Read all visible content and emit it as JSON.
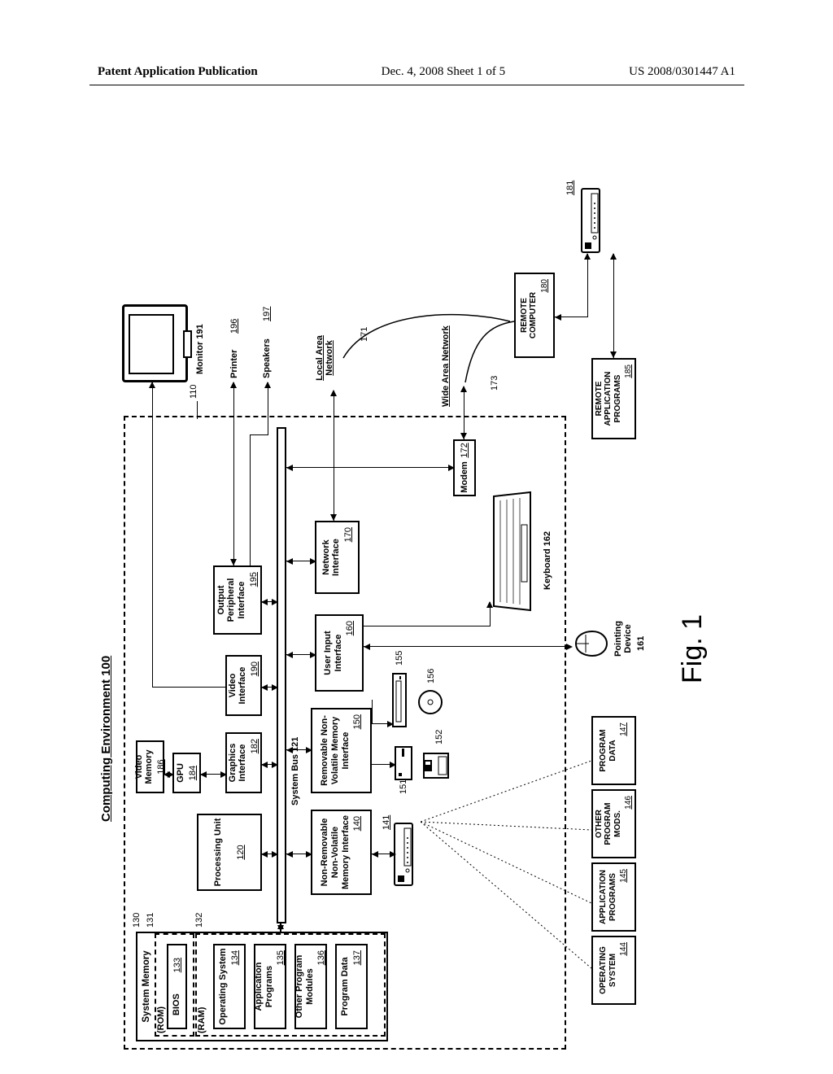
{
  "header": {
    "left": "Patent Application Publication",
    "center": "Dec. 4, 2008   Sheet 1 of 5",
    "right": "US 2008/0301447 A1"
  },
  "doc_title": "Computing Environment 100",
  "figure_label": "Fig. 1",
  "system_memory": {
    "title": "System Memory",
    "rom": "(ROM)",
    "ram": "(RAM)",
    "ref130": "130",
    "ref131": "131",
    "ref132": "132",
    "bios": "BIOS",
    "bios_ref": "133",
    "os": "Operating System",
    "os_ref": "134",
    "app": "Application Programs",
    "app_ref": "135",
    "other": "Other Program Modules",
    "other_ref": "136",
    "pdata": "Program Data",
    "pdata_ref": "137"
  },
  "cpu": {
    "label": "Processing Unit",
    "ref": "120"
  },
  "gpu": {
    "label": "GPU",
    "ref": "184"
  },
  "vmem": {
    "label": "Video Memory",
    "ref": "186"
  },
  "gfx": {
    "label": "Graphics Interface",
    "ref": "182"
  },
  "bus": "System Bus 121",
  "nrnv": {
    "label": "Non-Removable Non-Volatile Memory Interface",
    "ref": "140"
  },
  "rnv": {
    "label": "Removable Non-Volatile Memory Interface",
    "ref": "150"
  },
  "vint": {
    "label": "Video Interface",
    "ref": "190"
  },
  "opi": {
    "label": "Output Peripheral Interface",
    "ref": "195"
  },
  "uii": {
    "label": "User Input Interface",
    "ref": "160"
  },
  "nif": {
    "label": "Network Interface",
    "ref": "170"
  },
  "modem": {
    "label": "Modem",
    "ref": "172"
  },
  "monitor": "Monitor 191",
  "printer": "Printer",
  "printer_ref": "196",
  "speakers": "Speakers",
  "speakers_ref": "197",
  "lan": "Local Area Network",
  "wan": "Wide Area Network",
  "kbd": "Keyboard 162",
  "mouse": "Pointing Device",
  "mouse_ref": "161",
  "remote": {
    "label": "REMOTE COMPUTER",
    "ref": "180"
  },
  "rap": {
    "label": "REMOTE APPLICATION PROGRAMS",
    "ref": "185"
  },
  "hdd": {
    "os": "OPERATING SYSTEM",
    "os_ref": "144",
    "app": "APPLICATION PROGRAMS",
    "app_ref": "145",
    "other": "OTHER PROGRAM MODS.",
    "other_ref": "146",
    "pdata": "PROGRAM DATA",
    "pdata_ref": "147"
  },
  "refs": {
    "r110": "110",
    "r141": "141",
    "r151": "151",
    "r152": "152",
    "r155": "155",
    "r156": "156",
    "r171": "171",
    "r173": "173",
    "r181": "181"
  }
}
